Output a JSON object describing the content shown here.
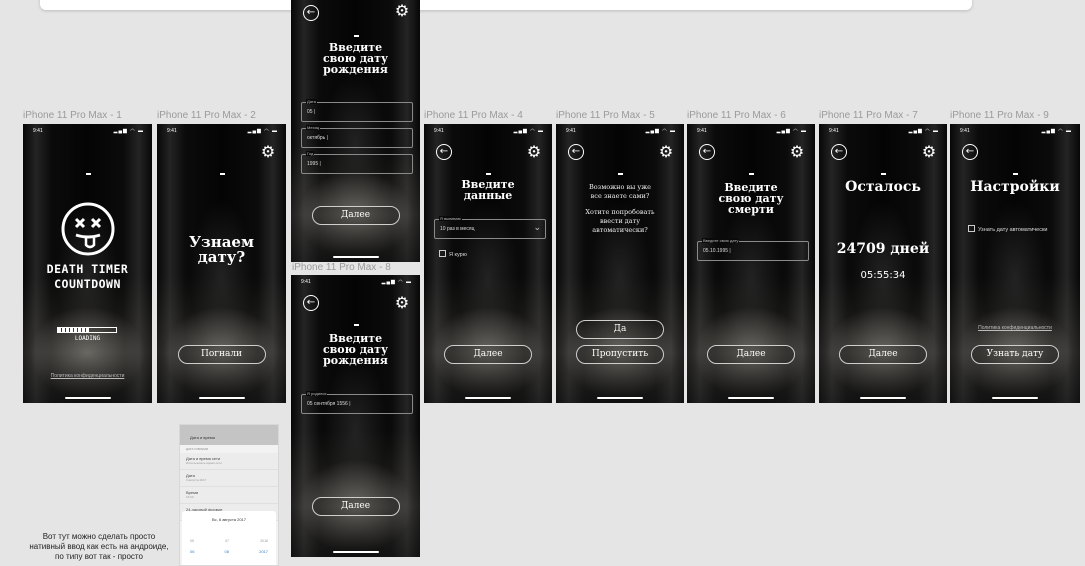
{
  "frame_labels": {
    "f1": "iPhone 11 Pro Max - 1",
    "f2": "iPhone 11 Pro Max - 2",
    "f4": "iPhone 11 Pro Max - 4",
    "f5": "iPhone 11 Pro Max - 5",
    "f6": "iPhone 11 Pro Max - 6",
    "f7": "iPhone 11 Pro Max - 7",
    "f9": "iPhone 11 Pro Max - 9",
    "f8": "iPhone 11 Pro Max - 8"
  },
  "status": {
    "time": "9:41",
    "icons": "▂▄▆ ◠ ▬"
  },
  "icons": {
    "back": "arrow-left-circle",
    "settings": "gear",
    "logo": "dizzy-face",
    "check": "checkbox"
  },
  "screen1": {
    "title_line1": "Death Timer",
    "title_line2": "Countdown",
    "loading": "LOADING",
    "privacy": "Политика конфиденциальности"
  },
  "screen2": {
    "title_line1": "Узнаем",
    "title_line2": "дату?",
    "button": "Погнали"
  },
  "screen3": {
    "title_line1": "Введите",
    "title_line2": "свою дату",
    "title_line3": "рождения",
    "day_label": "Дата",
    "day_value": "05 |",
    "month_label": "Месяц",
    "month_value": "октябрь |",
    "year_label": "Год",
    "year_value": "1995 |",
    "button": "Далее"
  },
  "screen4": {
    "title_line1": "Введите",
    "title_line2": "данные",
    "select_label": "Я выпиваю",
    "select_value": "10 раз в месяц",
    "checkbox": "Я курю",
    "button": "Далее"
  },
  "screen5": {
    "q_line1": "Возможно вы уже",
    "q_line2": "все знаете сами?",
    "q_line3": "Хотите попробовать",
    "q_line4": "ввести дату",
    "q_line5": "автоматически?",
    "yes": "Да",
    "skip": "Пропустить"
  },
  "screen6": {
    "title_line1": "Введите",
    "title_line2": "свою дату",
    "title_line3": "смерти",
    "field_label": "Введите свою дату",
    "field_value": "05.10.1995 |",
    "button": "Далее"
  },
  "screen7": {
    "title": "Осталось",
    "days": "24709 дней",
    "time": "05:55:34",
    "button": "Далее"
  },
  "screen9": {
    "title": "Настройки",
    "checkbox": "Узнать дату автоматически",
    "privacy": "Политика конфиденциальности",
    "button": "Узнать дату"
  },
  "screen8": {
    "title_line1": "Введите",
    "title_line2": "свою дату",
    "title_line3": "рождения",
    "field_label": "Я родился",
    "field_value": "05 сентября 1556 |",
    "button": "Далее"
  },
  "note": "Вот тут можно сделать просто нативный ввод как есть на андроиде, по типу вот так - просто",
  "native_picker": {
    "header": "Дата и время",
    "section": "ДАТА И ВРЕМЯ",
    "rows": [
      {
        "label": "Дата и время сети",
        "sub": "Использовать время сети"
      },
      {
        "label": "Дата",
        "sub": "9 августа 2017"
      },
      {
        "label": "Время",
        "sub": "16:00"
      },
      {
        "label": "24-часовой формат",
        "sub": ""
      }
    ],
    "modal_title": "Вс, 6 августа 2017",
    "col1": "05",
    "col2": "07",
    "col3": "2016",
    "sel1": "06",
    "sel2": "08",
    "sel3": "2017"
  }
}
